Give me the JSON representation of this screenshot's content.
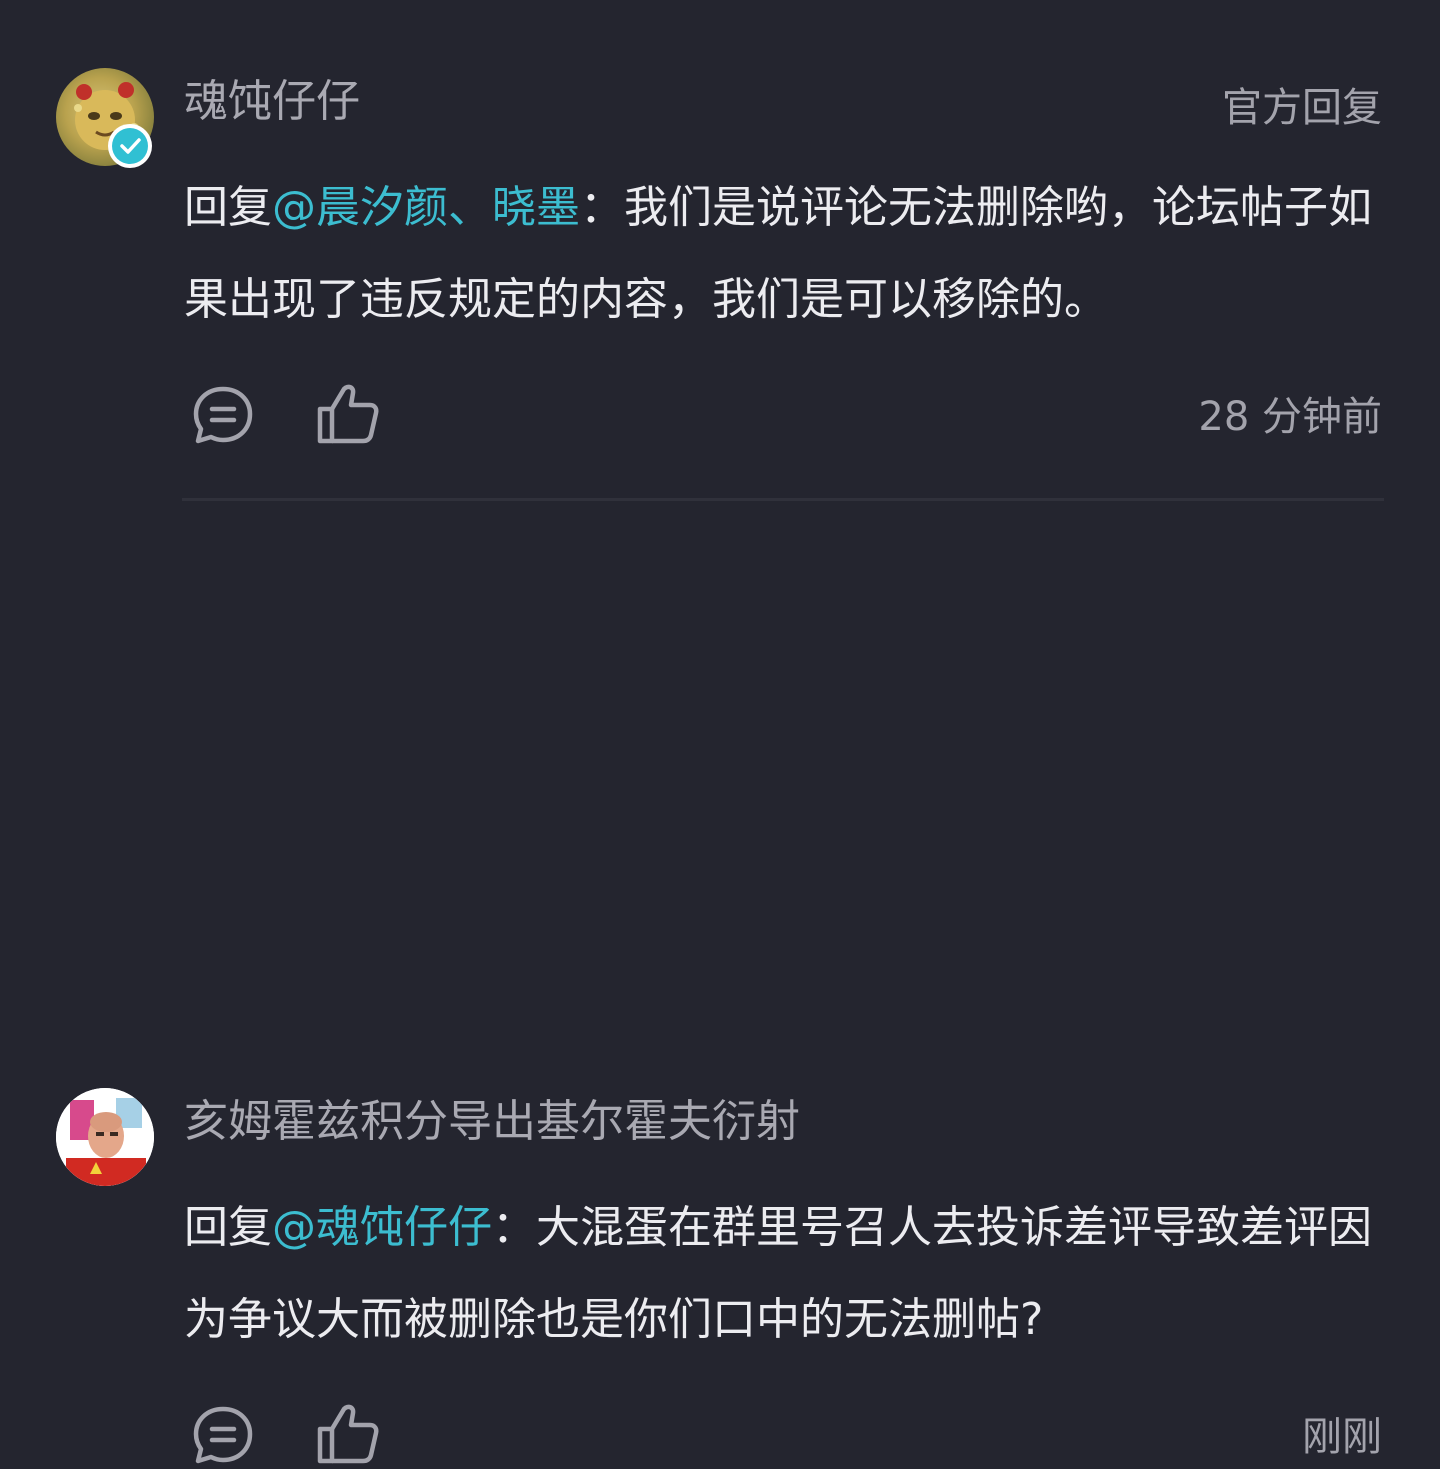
{
  "comments": [
    {
      "username": "魂饨仔仔",
      "official_tag": "官方回复",
      "reply_prefix": "回复",
      "mention": "@晨汐颜、晓墨",
      "content": "：我们是说评论无法删除哟，论坛帖子如果出现了违反规定的内容，我们是可以移除的。",
      "time": "28 分钟前",
      "verified": true
    },
    {
      "username": "亥姆霍兹积分导出基尔霍夫衍射",
      "reply_prefix": "回复",
      "mention": "@魂饨仔仔",
      "content": "：大混蛋在群里号召人去投诉差评导致差评因为争议大而被删除也是你们口中的无法删帖?",
      "time": "刚刚"
    }
  ],
  "icons": {
    "reply": "comment-bubble-icon",
    "like": "thumbs-up-icon",
    "verified": "verified-check-icon"
  },
  "colors": {
    "background": "#24252f",
    "mention": "#3cbdd0",
    "verified_badge": "#30c0d3",
    "muted_text": "#a3a3ac"
  }
}
